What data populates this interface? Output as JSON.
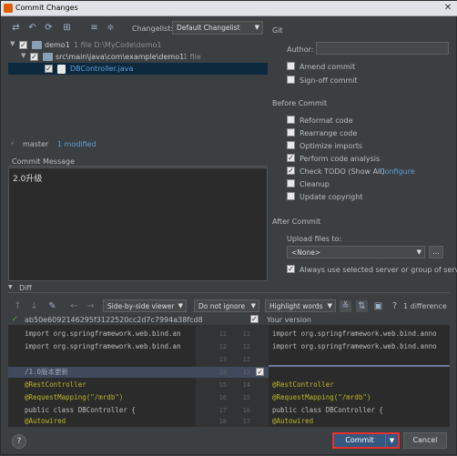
{
  "window": {
    "title": "Commit Changes"
  },
  "toolbar": {
    "changelist_label": "Changelist:",
    "changelist_value": "Default Changelist"
  },
  "tree": [
    {
      "label": "demo1",
      "meta": "1 file  D:\\MyCode\\demo1"
    },
    {
      "label": "src\\main\\java\\com\\example\\demo1",
      "meta": "1 file"
    },
    {
      "label": "DBController.java",
      "meta": ""
    }
  ],
  "branch": {
    "name": "master",
    "status": "1 modified"
  },
  "commit_message": {
    "label": "Commit Message",
    "text": "2.0升级"
  },
  "git": {
    "section": "Git",
    "author_label": "Author:",
    "amend": "Amend commit",
    "signoff": "Sign-off commit"
  },
  "before_commit": {
    "section": "Before Commit",
    "reformat": "Reformat code",
    "rearrange": "Rearrange code",
    "optimize": "Optimize imports",
    "analysis": "Perform code analysis",
    "todo": "Check TODO (Show All)",
    "configure": "Configure",
    "cleanup": "Cleanup",
    "copyright": "Update copyright"
  },
  "after_commit": {
    "section": "After Commit",
    "upload_label": "Upload files to:",
    "upload_value": "<None>",
    "upload_btn": "...",
    "always_use": "Always use selected server or group of servers"
  },
  "diff": {
    "label": "Diff",
    "viewer": "Side-by-side viewer",
    "ignore": "Do not ignore",
    "highlight": "Highlight words",
    "difference_count": "1 difference",
    "hash": "ab50e6092146295f3122520cc2d7c7994a38fcd8",
    "your_version": "Your version",
    "left_lines": [
      "import org.springframework.web.bind.an",
      "import org.springframework.web.bind.an",
      "",
      "/1.0版本更新",
      "@RestController",
      "@RequestMapping(\"/mrdb\")",
      "public class DBController {",
      "    @Autowired"
    ],
    "right_lines": [
      "import org.springframework.web.bind.anno",
      "import org.springframework.web.bind.anno",
      "",
      "",
      "@RestController",
      "@RequestMapping(\"/mrdb\")",
      "public class DBController {",
      "    @Autowired"
    ],
    "left_nums": [
      "11",
      "12",
      "13",
      "14",
      "15",
      "16",
      "17",
      "18"
    ],
    "right_nums": [
      "11",
      "12",
      "12",
      "13",
      "14",
      "15",
      "16",
      "17"
    ]
  },
  "buttons": {
    "help": "?",
    "commit": "Commit",
    "cancel": "Cancel"
  }
}
